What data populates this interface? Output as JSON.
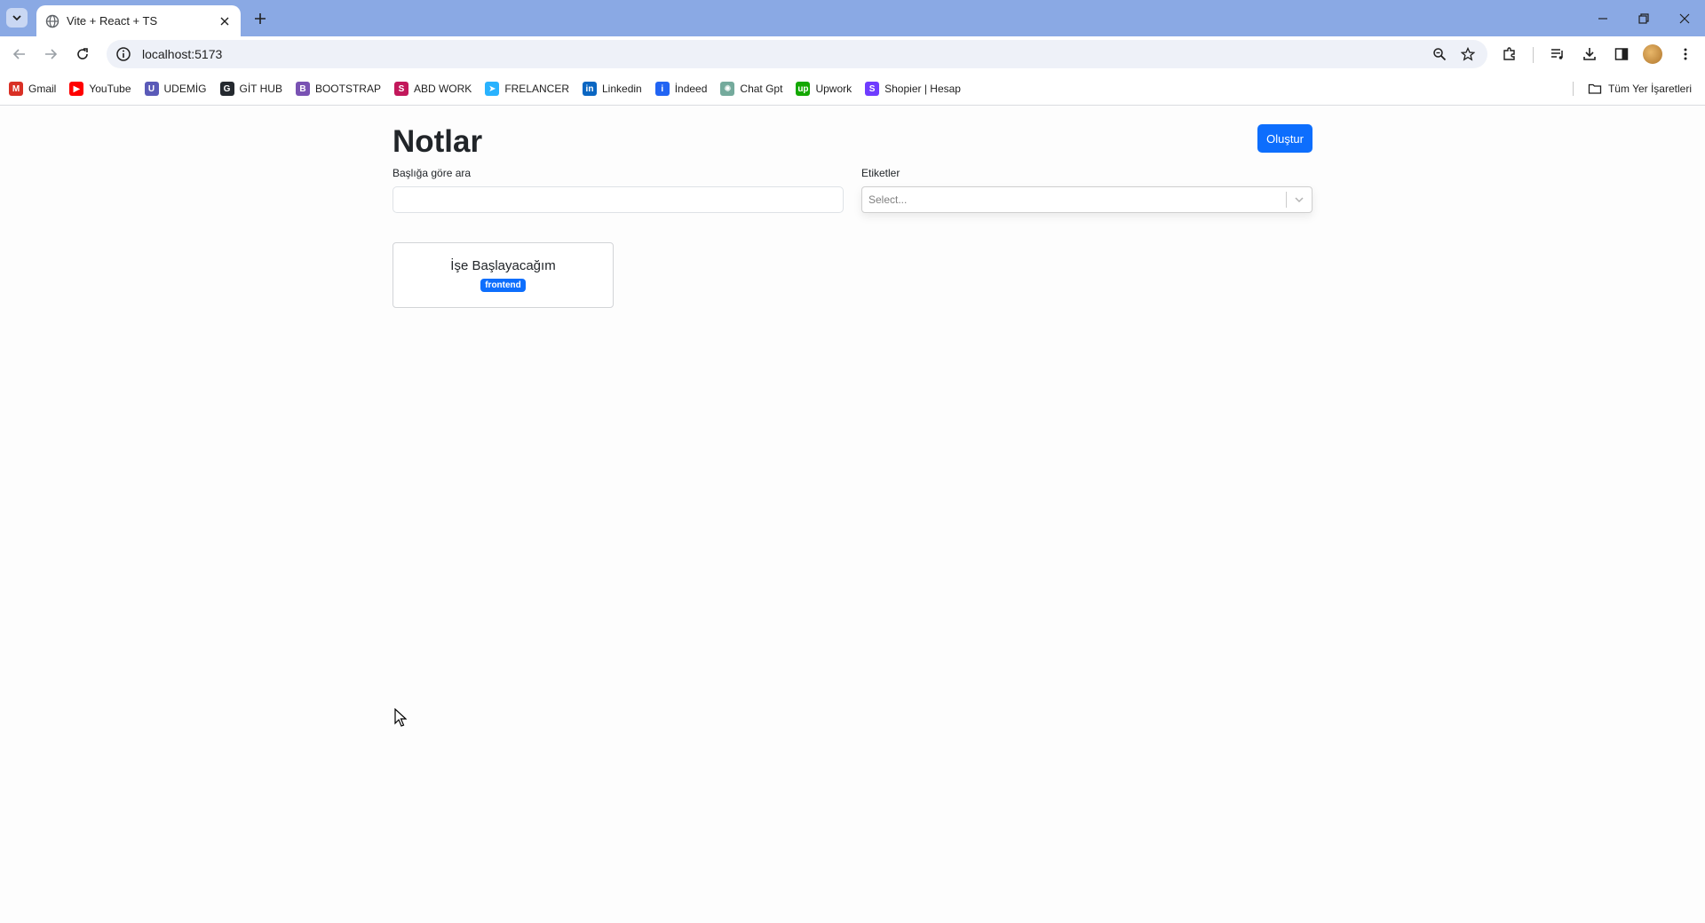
{
  "browser": {
    "tab_title": "Vite + React + TS",
    "url": "localhost:5173",
    "bookmarks": [
      {
        "label": "Gmail",
        "icon": "gmail-icon",
        "color": "#d93025",
        "glyph": "M"
      },
      {
        "label": "YouTube",
        "icon": "youtube-icon",
        "color": "#ff0000",
        "glyph": "▶"
      },
      {
        "label": "UDEMİG",
        "icon": "udemig-icon",
        "color": "#5a5ab8",
        "glyph": "U"
      },
      {
        "label": "GİT HUB",
        "icon": "github-icon",
        "color": "#24292f",
        "glyph": "G"
      },
      {
        "label": "BOOTSTRAP",
        "icon": "bootstrap-icon",
        "color": "#7952b3",
        "glyph": "B"
      },
      {
        "label": "ABD WORK",
        "icon": "abd-work-icon",
        "color": "#c2185b",
        "glyph": "S"
      },
      {
        "label": "FRELANCER",
        "icon": "freelancer-icon",
        "color": "#29b2fe",
        "glyph": "➤"
      },
      {
        "label": "Linkedin",
        "icon": "linkedin-icon",
        "color": "#0a66c2",
        "glyph": "in"
      },
      {
        "label": "İndeed",
        "icon": "indeed-icon",
        "color": "#2164f3",
        "glyph": "i"
      },
      {
        "label": "Chat Gpt",
        "icon": "chatgpt-icon",
        "color": "#74aa9c",
        "glyph": "✺"
      },
      {
        "label": "Upwork",
        "icon": "upwork-icon",
        "color": "#14a800",
        "glyph": "up"
      },
      {
        "label": "Shopier | Hesap",
        "icon": "shopier-icon",
        "color": "#6f3cff",
        "glyph": "S"
      }
    ],
    "all_bookmarks_label": "Tüm Yer İşaretleri"
  },
  "page": {
    "title": "Notlar",
    "create_button": "Oluştur",
    "search_label": "Başlığa göre ara",
    "search_value": "",
    "tags_label": "Etiketler",
    "tags_placeholder": "Select...",
    "notes": [
      {
        "title": "İşe Başlayacağım",
        "tags": [
          "frontend"
        ]
      }
    ]
  },
  "colors": {
    "primary": "#0d6efd",
    "titlebar": "#8aa9e4"
  }
}
